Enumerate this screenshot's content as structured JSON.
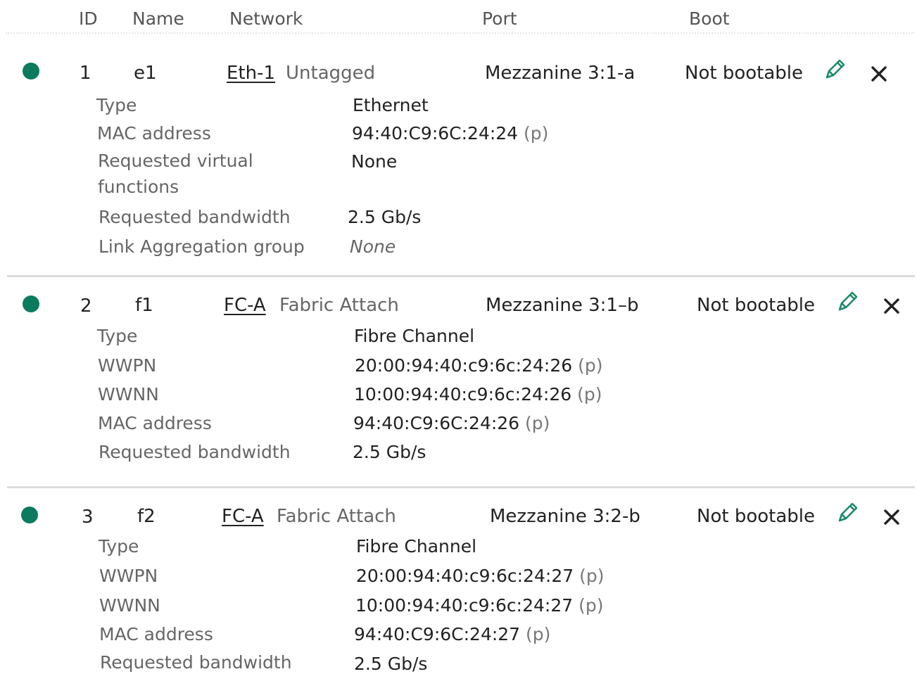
{
  "header": {
    "id": "ID",
    "name": "Name",
    "network": "Network",
    "port": "Port",
    "boot": "Boot"
  },
  "colors": {
    "status_ok": "#0b7a5e",
    "edit_icon": "#1c8a6a",
    "delete_icon": "#222222",
    "separator": "#dcdcdc"
  },
  "icons": {
    "status": "status-dot-icon",
    "edit": "pencil-icon",
    "delete": "close-icon"
  },
  "connections": [
    {
      "id": "1",
      "name": "e1",
      "network": "Eth-1",
      "vlan": "Untagged",
      "port": "Mezzanine 3:1-a",
      "boot": "Not bootable",
      "details": {
        "type_label": "Type",
        "type": "Ethernet",
        "mac_label": "MAC address",
        "mac": "94:40:C9:6C:24:24",
        "mac_suffix": "(p)",
        "vf_label": "Requested virtual functions",
        "vf": "None",
        "bw_label": "Requested bandwidth",
        "bw": "2.5 Gb/s",
        "lag_label": "Link Aggregation group",
        "lag": "None"
      }
    },
    {
      "id": "2",
      "name": "f1",
      "network": "FC-A",
      "vlan": "Fabric Attach",
      "port": "Mezzanine 3:1–b",
      "boot": "Not bootable",
      "details": {
        "type_label": "Type",
        "type": "Fibre Channel",
        "wwpn_label": "WWPN",
        "wwpn": "20:00:94:40:c9:6c:24:26",
        "wwpn_suffix": "(p)",
        "wwnn_label": "WWNN",
        "wwnn": "10:00:94:40:c9:6c:24:26",
        "wwnn_suffix": "(p)",
        "mac_label": "MAC address",
        "mac": "94:40:C9:6C:24:26",
        "mac_suffix": "(p)",
        "bw_label": "Requested bandwidth",
        "bw": "2.5 Gb/s"
      }
    },
    {
      "id": "3",
      "name": "f2",
      "network": "FC-A",
      "vlan": "Fabric Attach",
      "port": "Mezzanine 3:2-b",
      "boot": "Not bootable",
      "details": {
        "type_label": "Type",
        "type": "Fibre Channel",
        "wwpn_label": "WWPN",
        "wwpn": "20:00:94:40:c9:6c:24:27",
        "wwpn_suffix": "(p)",
        "wwnn_label": "WWNN",
        "wwnn": "10:00:94:40:c9:6c:24:27",
        "wwnn_suffix": "(p)",
        "mac_label": "MAC address",
        "mac": "94:40:C9:6C:24:27",
        "mac_suffix": "(p)",
        "bw_label": "Requested bandwidth",
        "bw": "2.5 Gb/s"
      }
    }
  ]
}
